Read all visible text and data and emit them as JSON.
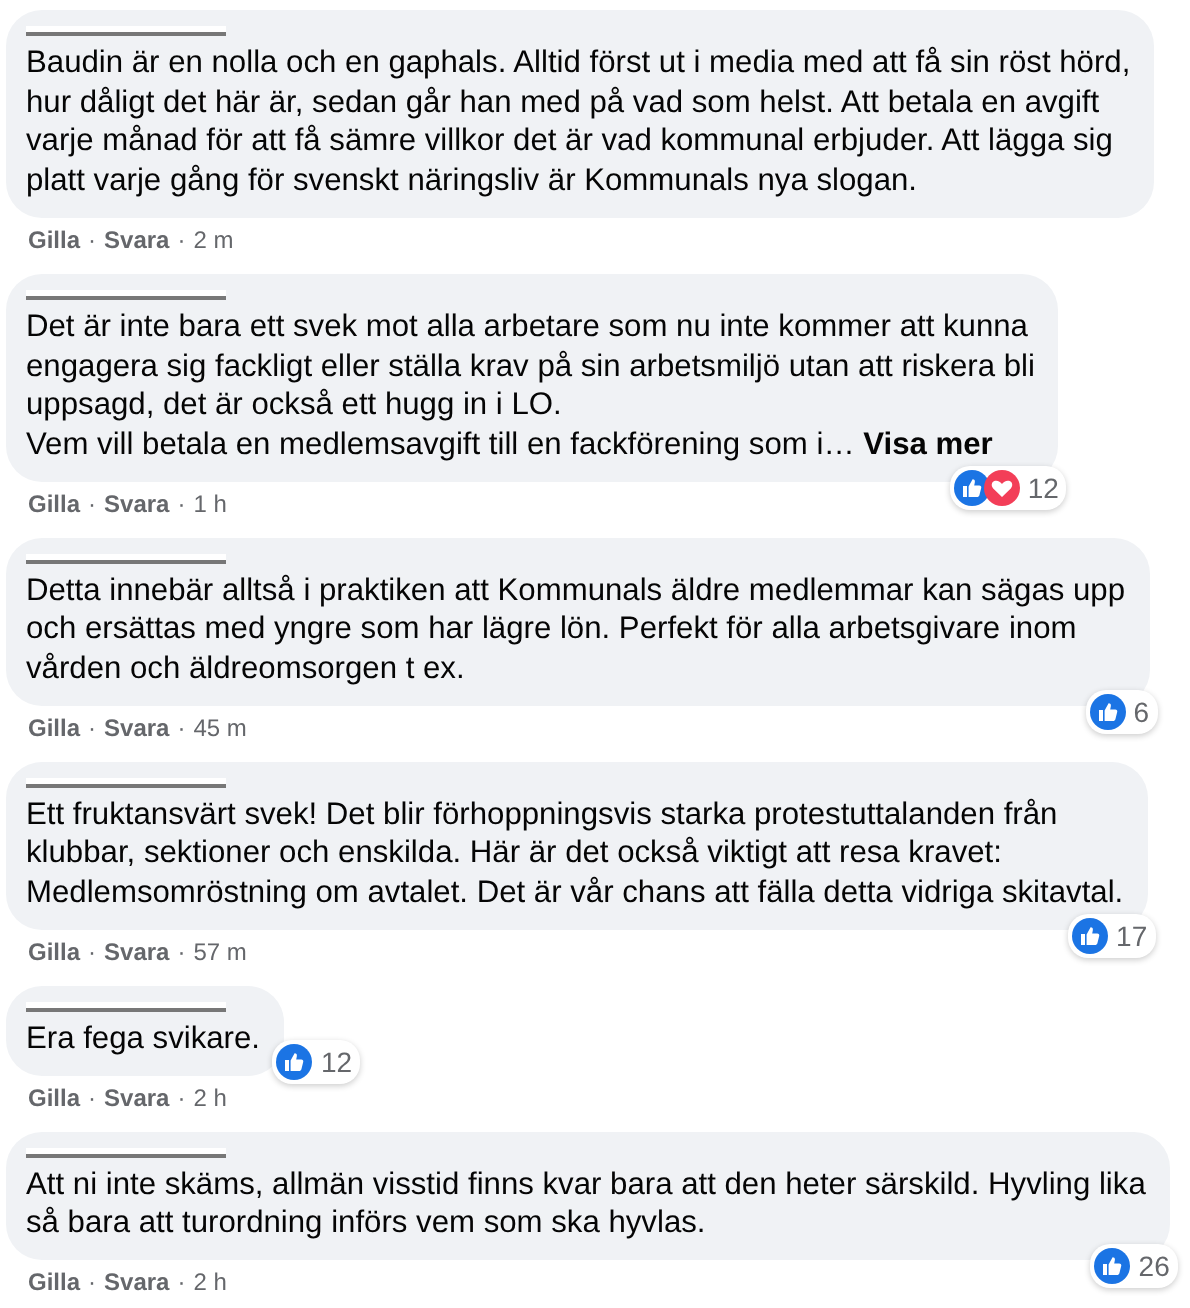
{
  "comments": [
    {
      "text": "Baudin är en nolla och en gaphals. Alltid först ut i media med att få sin röst hörd,\nhur dåligt det här är, sedan går han med på vad som helst. Att betala en avgift\nvarje månad för att få sämre villkor det är vad kommunal erbjuder. Att lägga sig\nplatt varje gång för svenskt näringsliv är Kommunals nya slogan.",
      "like": "Gilla",
      "separator_1": "·",
      "reply": "Svara",
      "separator_2": "·",
      "time": "2 m"
    },
    {
      "text": "Det är inte bara ett svek mot alla arbetare som nu inte kommer att kunna\nengagera sig fackligt eller ställa krav på sin arbetsmiljö utan att riskera bli\nuppsagd, det är också ett hugg in i LO.\nVem vill betala en medlemsavgift till en fackförening som i…",
      "see_more": "Visa mer",
      "like": "Gilla",
      "separator_1": "·",
      "reply": "Svara",
      "separator_2": "·",
      "time": "1 h",
      "liked": true,
      "loved": true,
      "reaction_count": "12"
    },
    {
      "text": "Detta innebär alltså i praktiken att Kommunals äldre medlemmar kan sägas upp\noch ersättas med yngre som har lägre lön. Perfekt för alla arbetsgivare inom\nvården och äldreomsorgen t ex.",
      "like": "Gilla",
      "separator_1": "·",
      "reply": "Svara",
      "separator_2": "·",
      "time": "45 m",
      "liked": true,
      "loved": false,
      "reaction_count": "6"
    },
    {
      "text": "Ett fruktansvärt svek! Det blir förhoppningsvis starka protestuttalanden från\nklubbar, sektioner och enskilda. Här är det också viktigt att resa kravet:\nMedlemsomröstning om avtalet. Det är vår chans att fälla detta vidriga skitavtal.",
      "like": "Gilla",
      "separator_1": "·",
      "reply": "Svara",
      "separator_2": "·",
      "time": "57 m",
      "liked": true,
      "loved": false,
      "reaction_count": "17"
    },
    {
      "text": "Era fega svikare.",
      "like": "Gilla",
      "separator_1": "·",
      "reply": "Svara",
      "separator_2": "·",
      "time": "2 h",
      "liked": true,
      "loved": false,
      "reaction_count": "12"
    },
    {
      "text": "Att ni inte skäms, allmän visstid finns kvar bara att den heter särskild. Hyvling lika\nså bara att turordning införs vem som ska hyvlas.",
      "like": "Gilla",
      "separator_1": "·",
      "reply": "Svara",
      "separator_2": "·",
      "time": "2 h",
      "liked": true,
      "loved": false,
      "reaction_count": "26"
    }
  ]
}
